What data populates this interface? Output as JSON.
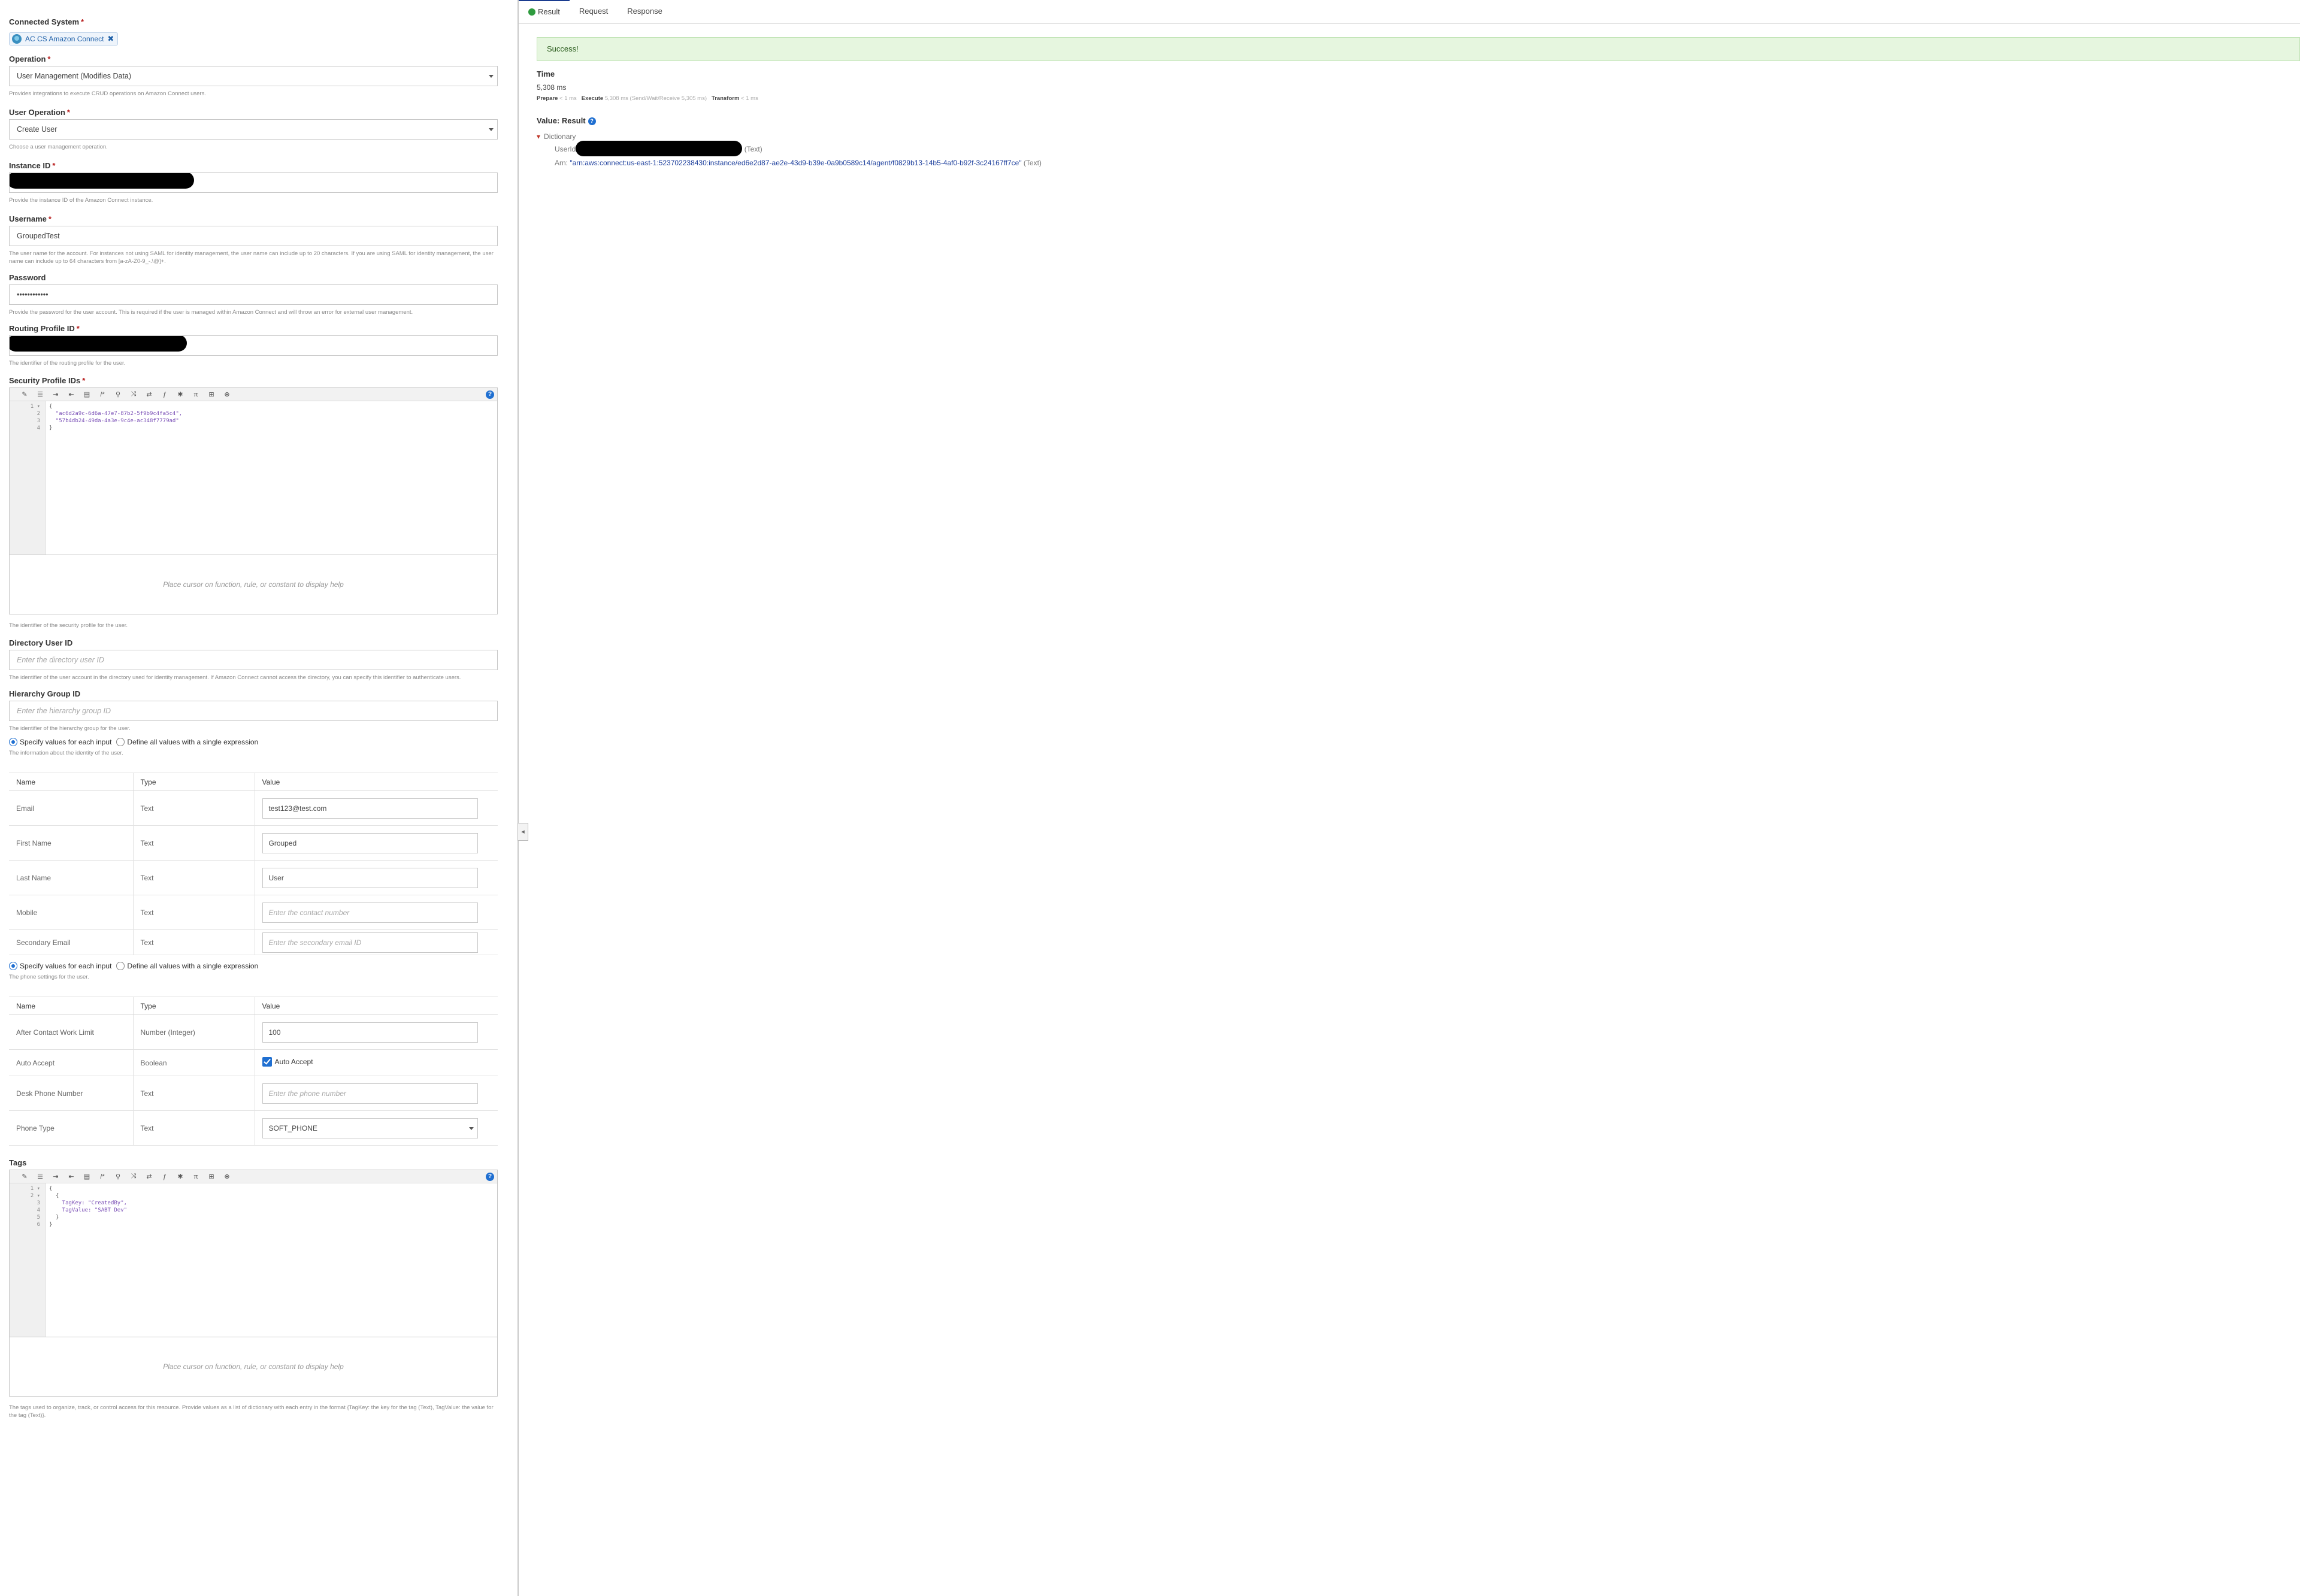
{
  "form": {
    "connected_system": {
      "label": "Connected System",
      "value": "AC CS Amazon Connect"
    },
    "operation": {
      "label": "Operation",
      "value": "User Management (Modifies Data)",
      "help": "Provides integrations to execute CRUD operations on Amazon Connect users."
    },
    "user_operation": {
      "label": "User Operation",
      "value": "Create User",
      "help": "Choose a user management operation."
    },
    "instance_id": {
      "label": "Instance ID",
      "help": "Provide the instance ID of the Amazon Connect instance."
    },
    "username": {
      "label": "Username",
      "value": "GroupedTest",
      "help": "The user name for the account. For instances not using SAML for identity management, the user name can include up to 20 characters. If you are using SAML for identity management, the user name can include up to 64 characters from [a-zA-Z0-9_-.\\@]+."
    },
    "password": {
      "label": "Password",
      "value": "••••••••••••",
      "help": "Provide the password for the user account. This is required if the user is managed within Amazon Connect and will throw an error for external user management."
    },
    "routing_profile_id": {
      "label": "Routing Profile ID",
      "help": "The identifier of the routing profile for the user."
    },
    "security_profile_ids": {
      "label": "Security Profile IDs",
      "gutter": [
        "1 ▾",
        "2",
        "3",
        "4"
      ],
      "code": [
        "{",
        "  \"ac6d2a9c-6d6a-47e7-87b2-5f9b9c4fa5c4\",",
        "  \"57b4db24-49da-4a3e-9c4e-ac348f7779ad\"",
        "}"
      ],
      "hint": "Place cursor on function, rule, or constant to display help",
      "help": "The identifier of the security profile for the user."
    },
    "directory_user_id": {
      "label": "Directory User ID",
      "placeholder": "Enter the directory user ID",
      "help": "The identifier of the user account in the directory used for identity management. If Amazon Connect cannot access the directory, you can specify this identifier to authenticate users."
    },
    "hierarchy_group_id": {
      "label": "Hierarchy Group ID",
      "placeholder": "Enter the hierarchy group ID",
      "help": "The identifier of the hierarchy group for the user."
    },
    "identity_info": {
      "radio_a": "Specify values for each input",
      "radio_b": "Define all values with a single expression",
      "help": "The information about the identity of the user.",
      "headers": {
        "name": "Name",
        "type": "Type",
        "value": "Value"
      },
      "rows": [
        {
          "name": "Email",
          "type": "Text",
          "value": "test123@test.com"
        },
        {
          "name": "First Name",
          "type": "Text",
          "value": "Grouped"
        },
        {
          "name": "Last Name",
          "type": "Text",
          "value": "User"
        },
        {
          "name": "Mobile",
          "type": "Text",
          "placeholder": "Enter the contact number"
        },
        {
          "name": "Secondary Email",
          "type": "Text",
          "placeholder": "Enter the secondary email ID"
        }
      ]
    },
    "phone_config": {
      "radio_a": "Specify values for each input",
      "radio_b": "Define all values with a single expression",
      "help": "The phone settings for the user.",
      "headers": {
        "name": "Name",
        "type": "Type",
        "value": "Value"
      },
      "acw": {
        "name": "After Contact Work Limit",
        "type": "Number (Integer)",
        "value": "100"
      },
      "auto_accept": {
        "name": "Auto Accept",
        "type": "Boolean",
        "value": "Auto Accept"
      },
      "desk_phone": {
        "name": "Desk Phone Number",
        "type": "Text",
        "placeholder": "Enter the phone number"
      },
      "phone_type": {
        "name": "Phone Type",
        "type": "Text",
        "value": "SOFT_PHONE"
      }
    },
    "tags": {
      "label": "Tags",
      "gutter": [
        "1 ▾",
        "2 ▾",
        "3",
        "4",
        "5",
        "6"
      ],
      "code": [
        "{",
        "  {",
        "    TagKey: \"CreatedBy\",",
        "    TagValue: \"SABT Dev\"",
        "  }",
        "}"
      ],
      "hint": "Place cursor on function, rule, or constant to display help",
      "help": "The tags used to organize, track, or control access for this resource. Provide values as a list of dictionary with each entry in the format {TagKey: the key for the tag (Text), TagValue: the value for the tag (Text)}."
    }
  },
  "results": {
    "tabs": [
      "Result",
      "Request",
      "Response"
    ],
    "status": "Success!",
    "time_label": "Time",
    "time_value": "5,308 ms",
    "phases": {
      "prepare": "Prepare",
      "prepare_val": "< 1 ms",
      "execute": "Execute",
      "execute_val": "5,308 ms (Send/Wait/Receive 5,305 ms)",
      "transform": "Transform",
      "transform_val": "< 1 ms"
    },
    "value_label": "Value: Result",
    "tree": {
      "root": "Dictionary",
      "userid_key": "UserId",
      "userid_type": "(Text)",
      "arn_key": "Arn",
      "arn_value": "\"arn:aws:connect:us-east-1:523702238430:instance/ed6e2d87-ae2e-43d9-b39e-0a9b0589c14/agent/f0829b13-14b5-4af0-b92f-3c24167ff7ce\"",
      "arn_type": "(Text)"
    }
  },
  "icons": {
    "collapse": "collapse-left-icon",
    "success": "success-check-icon",
    "help": "help-icon"
  }
}
